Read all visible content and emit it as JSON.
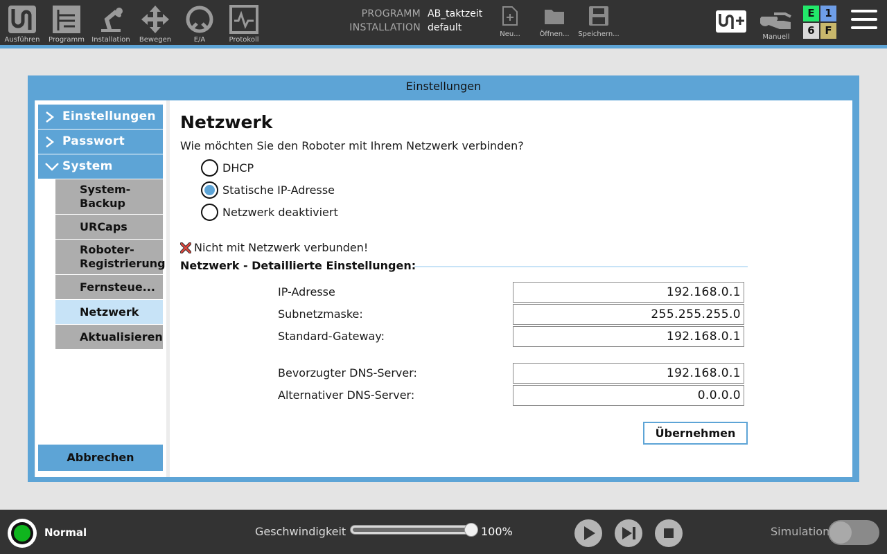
{
  "toolbar": {
    "items": [
      {
        "label": "Ausführen",
        "icon": "run-icon"
      },
      {
        "label": "Programm",
        "icon": "program-icon"
      },
      {
        "label": "Installation",
        "icon": "installation-icon"
      },
      {
        "label": "Bewegen",
        "icon": "move-icon"
      },
      {
        "label": "E/A",
        "icon": "io-icon"
      },
      {
        "label": "Protokoll",
        "icon": "log-icon"
      }
    ],
    "program_label": "PROGRAMM",
    "program_value": "AB_taktzeit",
    "installation_label": "INSTALLATION",
    "installation_value": "default",
    "file_buttons": [
      {
        "label": "Neu...",
        "icon": "new-file-icon"
      },
      {
        "label": "Öffnen...",
        "icon": "open-folder-icon"
      },
      {
        "label": "Speichern...",
        "icon": "save-icon"
      }
    ],
    "urplus_icon": "urplus-icon",
    "mode_label": "Manuell",
    "status_grid": {
      "e": "E",
      "one": "1",
      "six": "6",
      "f": "F"
    },
    "status_colors": {
      "e": "#22e86a",
      "one": "#6e9ee8",
      "six": "#d9d9d9",
      "f": "#c9b86c"
    }
  },
  "dialog": {
    "title": "Einstellungen",
    "nav": {
      "main": [
        {
          "label": "Einstellungen",
          "state": "collapsed"
        },
        {
          "label": "Passwort",
          "state": "collapsed"
        },
        {
          "label": "System",
          "state": "expanded"
        }
      ],
      "sub": [
        {
          "label": "System-\nBackup"
        },
        {
          "label": "URCaps"
        },
        {
          "label": "Roboter-\nRegistrierung"
        },
        {
          "label": "Fernsteue..."
        },
        {
          "label": "Netzwerk",
          "active": true
        },
        {
          "label": "Aktualisieren"
        }
      ],
      "cancel_label": "Abbrechen"
    },
    "content": {
      "title": "Netzwerk",
      "question": "Wie möchten Sie den Roboter mit Ihrem Netzwerk verbinden?",
      "options": [
        {
          "label": "DHCP",
          "checked": false
        },
        {
          "label": "Statische IP-Adresse",
          "checked": true
        },
        {
          "label": "Netzwerk deaktiviert",
          "checked": false
        }
      ],
      "status_text": "Nicht mit Netzwerk verbunden!",
      "section_title": "Netzwerk - Detaillierte Einstellungen:",
      "fields": {
        "ip": {
          "label": "IP-Adresse",
          "value": "192.168.0.1"
        },
        "subnet": {
          "label": "Subnetzmaske:",
          "value": "255.255.255.0"
        },
        "gateway": {
          "label": "Standard-Gateway:",
          "value": "192.168.0.1"
        },
        "dns1": {
          "label": "Bevorzugter DNS-Server:",
          "value": "192.168.0.1"
        },
        "dns2": {
          "label": "Alternativer DNS-Server:",
          "value": "0.0.0.0"
        }
      },
      "apply_label": "Übernehmen"
    }
  },
  "bottom": {
    "status_text": "Normal",
    "status_color": "#0fb51e",
    "speed_label": "Geschwindigkeit",
    "speed_value": "100%",
    "speed_fraction": 1.0,
    "controls": [
      "play-icon",
      "step-icon",
      "stop-icon"
    ],
    "simulation_label": "Simulation",
    "simulation_on": false
  },
  "colors": {
    "accent": "#5da4d6",
    "accent_light": "#c7e3f7",
    "bar": "#333333"
  }
}
